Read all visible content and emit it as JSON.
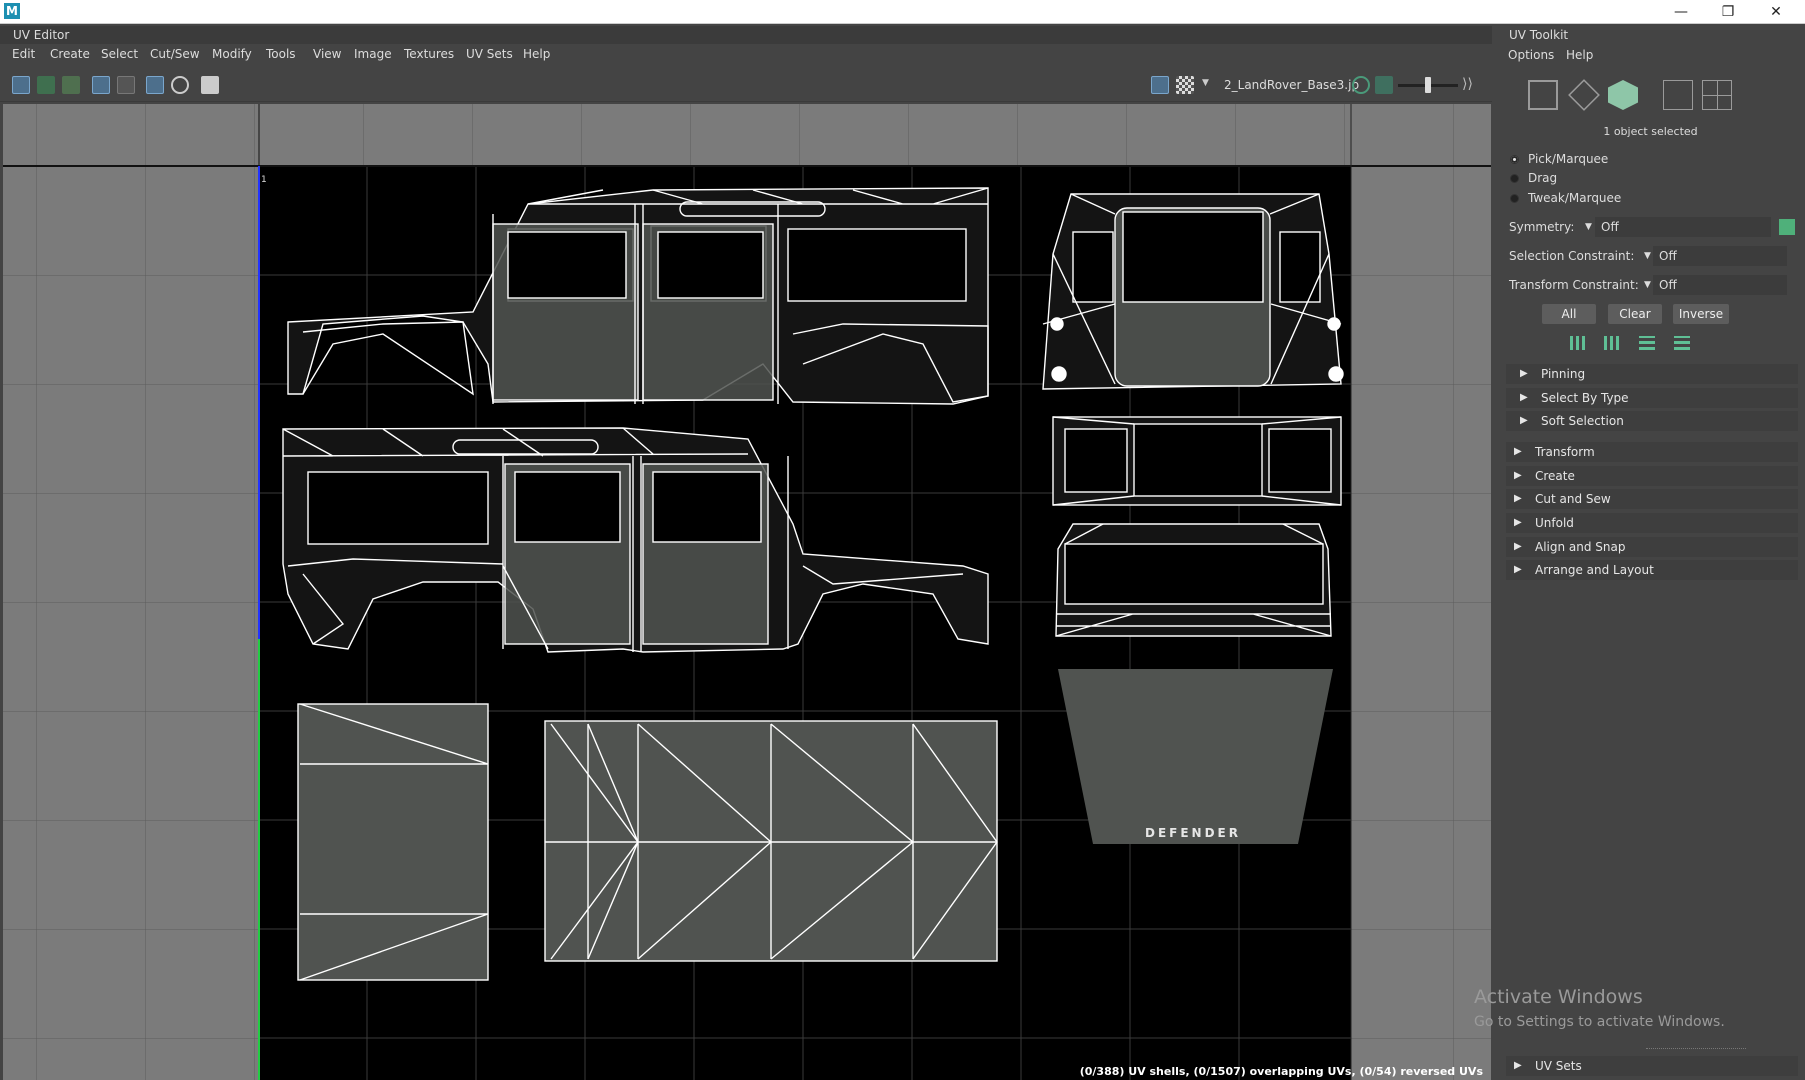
{
  "window": {
    "app_logo_letter": "M",
    "minimize": "—",
    "restore": "❐",
    "close": "✕"
  },
  "uv_editor": {
    "title": "UV Editor",
    "menu": [
      "Edit",
      "Create",
      "Select",
      "Cut/Sew",
      "Modify",
      "Tools",
      "View",
      "Image",
      "Textures",
      "UV Sets",
      "Help"
    ],
    "image_name": "2_LandRover_Base3.jp",
    "tile_label": "1",
    "status": "(0/388) UV shells, (0/1507) overlapping UVs, (0/54) reversed UVs",
    "decal_text": "DEFENDER"
  },
  "uv_toolkit": {
    "title": "UV Toolkit",
    "menu": [
      "Options",
      "Help"
    ],
    "selection_info": "1 object selected",
    "modes": [
      {
        "label": "Pick/Marquee",
        "selected": true
      },
      {
        "label": "Drag",
        "selected": false
      },
      {
        "label": "Tweak/Marquee",
        "selected": false
      }
    ],
    "symmetry": {
      "label": "Symmetry:",
      "value": "Off"
    },
    "selection_constraint": {
      "label": "Selection Constraint:",
      "value": "Off"
    },
    "transform_constraint": {
      "label": "Transform Constraint:",
      "value": "Off"
    },
    "buttons": {
      "all": "All",
      "clear": "Clear",
      "inverse": "Inverse"
    },
    "sub_sections": [
      "Pinning",
      "Select By Type",
      "Soft Selection"
    ],
    "sections": [
      "Transform",
      "Create",
      "Cut and Sew",
      "Unfold",
      "Align and Snap",
      "Arrange and Layout"
    ],
    "uv_sets_section": "UV Sets"
  },
  "overlay": {
    "activate_title": "Activate Windows",
    "activate_sub": "Go to Settings to activate Windows."
  },
  "colors": {
    "accent": "#4a90d9",
    "panel": "#444444",
    "grid": "#7b7b7b",
    "texture_bg": "#000000",
    "wire": "#ffffff",
    "fill": "#545650"
  }
}
